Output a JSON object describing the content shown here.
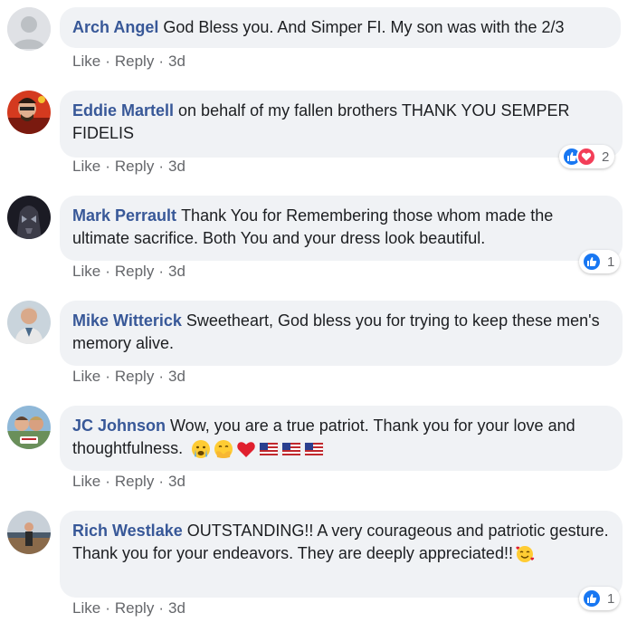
{
  "actions": {
    "like_label": "Like",
    "reply_label": "Reply",
    "separator": "·"
  },
  "comments": [
    {
      "author": "Arch Angel",
      "text": "God Bless you. And Simper FI. My son was with the 2/3",
      "time": "3d",
      "reactions": null
    },
    {
      "author": "Eddie Martell",
      "text": "on behalf of my fallen brothers THANK YOU SEMPER FIDELIS",
      "time": "3d",
      "reactions": {
        "types": [
          "like-icon",
          "love-icon"
        ],
        "count": "2"
      }
    },
    {
      "author": "Mark Perrault",
      "text": "Thank You for Remembering those whom made the ultimate sacrifice. Both You and your dress look beautiful.",
      "time": "3d",
      "reactions": {
        "types": [
          "like-icon"
        ],
        "count": "1"
      }
    },
    {
      "author": "Mike Witterick",
      "text": "Sweetheart, God bless you for trying to keep these men's memory alive.",
      "time": "3d",
      "reactions": null
    },
    {
      "author": "JC Johnson",
      "text": "Wow, you are a true patriot. Thank you for your love and thoughtfulness.",
      "emojis": [
        "crying-face-emoji",
        "smiling-with-hands-emoji",
        "red-heart-emoji",
        "us-flag-emoji",
        "us-flag-emoji",
        "us-flag-emoji"
      ],
      "time": "3d",
      "reactions": null
    },
    {
      "author": "Rich Westlake",
      "text": "OUTSTANDING!! A very courageous and patriotic gesture. Thank you for your endeavors. They are deeply appreciated!!",
      "emojis": [
        "smiling-face-with-hearts-emoji"
      ],
      "time": "3d",
      "reactions": {
        "types": [
          "like-icon"
        ],
        "count": "1"
      }
    }
  ],
  "colors": {
    "author": "#385898",
    "bubble": "#f0f2f5",
    "like": "#1877f2",
    "love": "#f33e58",
    "meta": "#65676b"
  }
}
